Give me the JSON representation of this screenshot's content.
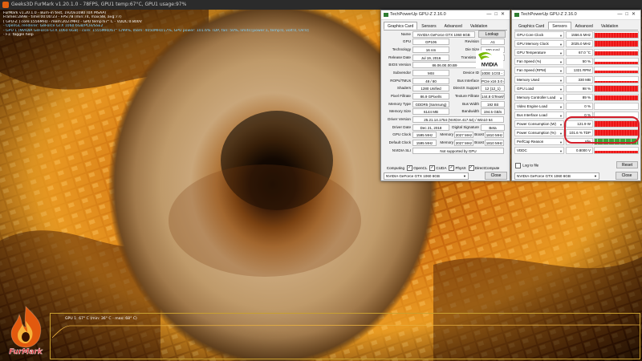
{
  "furmark": {
    "window_title": "Geeks3D FurMark v1.20.1.0 - 78FPS, GPU1 temp:67°C, GPU1 usage:97%",
    "osd_lines": [
      {
        "text": "FurMark v1.20.1.0 - Burn-in test, 1920x1080 (0X MSAA)",
        "color": "#ffffff"
      },
      {
        "text": "Frames:2898 - time:00:00:23 - FPS:78 (min:74, max:88, avg:77)",
        "color": "#ffffff"
      },
      {
        "text": "[ GPU-Z ] core:1556MHz - mem:2027MHz - GPU temp:67° C - VDDC:0.800V",
        "color": "#ffffff"
      },
      {
        "text": "- OpenGL renderer: GeForce GTX 1060 6GB/PCIe/SSE2",
        "color": "#7fd4ff"
      },
      {
        "text": "- GPU 1 (NVIDIA GeForce GTX 1060 6GB) - core: 1555MHz/67° C/99%, mem: 4050MHz/17%, GPU power: 101.6% TDP, fan: 50%, limits:[power:1, temp:0, volt:0, OV:0]",
        "color": "#7fd4ff"
      },
      {
        "text": "- F1: toggle help",
        "color": "#ffffff"
      }
    ],
    "logo_text": "FurMark",
    "temp_graph_label": "GPU 1: 67° C (min: 36° C - max: 68° C)"
  },
  "gpuz_card": {
    "title": "TechPowerUp GPU-Z 2.16.0",
    "tabs": [
      "Graphics Card",
      "Sensors",
      "Advanced",
      "Validation"
    ],
    "active_tab": 0,
    "rows": [
      {
        "label": "Name",
        "cells": [
          "NVIDIA GeForce GTX 1060 6GB"
        ],
        "button": "Lookup"
      },
      {
        "label": "GPU",
        "cells": [
          "GP106"
        ],
        "label2": "Revision",
        "cells2": [
          "A1"
        ]
      },
      {
        "label": "Technology",
        "cells": [
          "16 nm"
        ],
        "label2": "Die Size",
        "cells2": [
          "200 mm²"
        ]
      },
      {
        "label": "Release Date",
        "cells": [
          "Jul 19, 2016"
        ],
        "label2": "Transistors",
        "cells2": [
          "4400M"
        ]
      },
      {
        "label": "BIOS Version",
        "cells": [
          "86.06.0E.00.B9"
        ],
        "uefi": "UEFI"
      },
      {
        "label": "Subvendor",
        "cells": [
          "MSI"
        ],
        "label2": "Device ID",
        "cells2": [
          "10DE 1C03 - 1462 8C94"
        ]
      },
      {
        "label": "ROPs/TMUs",
        "cells": [
          "48 / 80"
        ],
        "label2": "Bus Interface",
        "cells2": [
          "PCIe x16 3.0 @ x16 3.0"
        ]
      },
      {
        "label": "Shaders",
        "cells": [
          "1280 Unified"
        ],
        "label2": "DirectX Support",
        "cells2": [
          "12 (12_1)"
        ]
      },
      {
        "label": "Pixel Fillrate",
        "cells": [
          "86.9 GPixel/s"
        ],
        "label2": "Texture Fillrate",
        "cells2": [
          "144.8 GTexel/s"
        ]
      },
      {
        "label": "Memory Type",
        "cells": [
          "GDDR5 (Samsung)"
        ],
        "label2": "Bus Width",
        "cells2": [
          "192 Bit"
        ]
      },
      {
        "label": "Memory Size",
        "cells": [
          "6144 MB"
        ],
        "label2": "Bandwidth",
        "cells2": [
          "194.5 GB/s"
        ]
      },
      {
        "label": "Driver Version",
        "cells": [
          "25.21.14.1754 (NVIDIA 417.54) / Win10 64"
        ]
      },
      {
        "label": "Driver Date",
        "cells": [
          "Dec 21, 2018"
        ],
        "label2": "Digital Signature",
        "cells2": [
          "Beta"
        ]
      },
      {
        "label": "GPU Clock",
        "cells": [
          "1595 MHz"
        ],
        "label2": "Memory",
        "cells2": [
          "2027 MHz"
        ],
        "label3": "Boost",
        "cells3": [
          "1810 MHz"
        ]
      },
      {
        "label": "Default Clock",
        "cells": [
          "1595 MHz"
        ],
        "label2": "Memory",
        "cells2": [
          "2027 MHz"
        ],
        "label3": "Boost",
        "cells3": [
          "1810 MHz"
        ]
      },
      {
        "label": "NVIDIA SLI",
        "cells": [
          "Not supported by GPU"
        ]
      }
    ],
    "computing_label": "Computing",
    "computing": [
      {
        "label": "OpenCL",
        "checked": true
      },
      {
        "label": "CUDA",
        "checked": true
      },
      {
        "label": "PhysX",
        "checked": true
      },
      {
        "label": "DirectCompute 5.0",
        "checked": true
      }
    ],
    "logo_text": "NVIDIA",
    "device_select": "NVIDIA GeForce GTX 1060 6GB",
    "close_label": "Close"
  },
  "gpuz_sensors": {
    "title": "TechPowerUp GPU-Z 2.16.0",
    "tabs": [
      "Graphics Card",
      "Sensors",
      "Advanced",
      "Validation"
    ],
    "active_tab": 1,
    "rows": [
      {
        "label": "GPU Core Clock",
        "value": "1556.5 MHz",
        "level": 0.9
      },
      {
        "label": "GPU Memory Clock",
        "value": "2025.0 MHz",
        "level": 0.95
      },
      {
        "label": "GPU Temperature",
        "value": "67.0 °C",
        "level": 0.75
      },
      {
        "label": "Fan Speed (%)",
        "value": "50 %",
        "level": 0.5
      },
      {
        "label": "Fan Speed (RPM)",
        "value": "1321 RPM",
        "level": 0.55
      },
      {
        "label": "Memory Used",
        "value": "330 MB",
        "level": 0.15
      },
      {
        "label": "GPU Load",
        "value": "98 %",
        "level": 0.97
      },
      {
        "label": "Memory Controller Load",
        "value": "89 %",
        "level": 0.88
      },
      {
        "label": "Video Engine Load",
        "value": "0 %",
        "level": 0
      },
      {
        "label": "Bus Interface Load",
        "value": "0 %",
        "level": 0
      },
      {
        "label": "Power Consumption (W)",
        "value": "121.9 W",
        "level": 0.95
      },
      {
        "label": "Power Consumption (%)",
        "value": "101.6 % TDP",
        "level": 0.97
      },
      {
        "label": "PerfCap Reason",
        "value": "Idle",
        "level": 0.6
      },
      {
        "label": "VDDC",
        "value": "0.8000 V",
        "level": 0.5
      }
    ],
    "graph_color": "#e00000",
    "perfcap_color": "#3aa53a",
    "log_label": "Log to file",
    "reset_label": "Reset",
    "device_select": "NVIDIA GeForce GTX 1060 6GB",
    "close_label": "Close",
    "highlight_color": "#d21e2a"
  }
}
